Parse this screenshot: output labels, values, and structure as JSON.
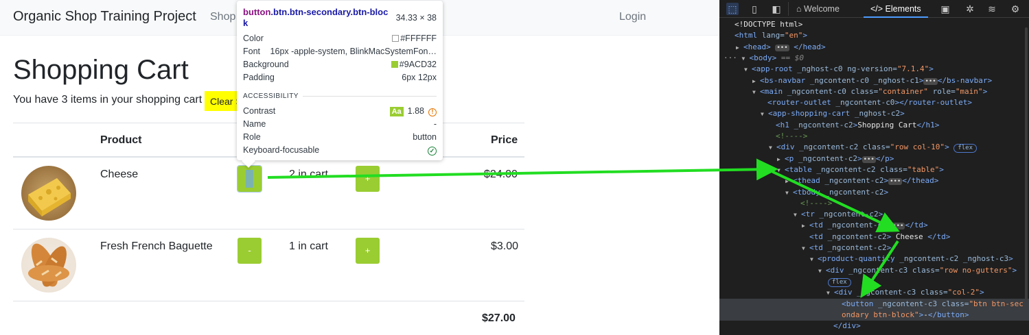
{
  "navbar": {
    "brand": "Organic Shop Training Project",
    "shop_link": "Shop",
    "login": "Login"
  },
  "page": {
    "title": "Shopping Cart",
    "cart_info": "You have 3 items in your shopping cart",
    "clear_button": "Clear Shopping Cart",
    "headers": {
      "product": "Product",
      "price": "Price"
    },
    "items": [
      {
        "name": "Cheese",
        "qty_label": "2 in cart",
        "minus": "-",
        "plus": "+",
        "price": "$24.00"
      },
      {
        "name": "Fresh French Baguette",
        "qty_label": "1 in cart",
        "minus": "-",
        "plus": "+",
        "price": "$3.00"
      }
    ],
    "total": "$27.00"
  },
  "tooltip": {
    "selector": "button",
    "classes": ".btn.btn-secondary.btn-bloc",
    "classes_wrap": "k",
    "dims": "34.33 × 38",
    "rows": [
      {
        "key": "Color",
        "value": "#FFFFFF",
        "swatch": "#FFFFFF"
      },
      {
        "key": "Font",
        "value": "16px -apple-system, BlinkMacSystemFon…"
      },
      {
        "key": "Background",
        "value": "#9ACD32",
        "swatch": "#9ACD32"
      },
      {
        "key": "Padding",
        "value": "6px 12px"
      }
    ],
    "section": "ACCESSIBILITY",
    "contrast_label": "Contrast",
    "contrast_badge": "Aa",
    "contrast_value": "1.88",
    "name_label": "Name",
    "name_value": "-",
    "role_label": "Role",
    "role_value": "button",
    "focus_label": "Keyboard-focusable"
  },
  "devtools": {
    "tabs": {
      "welcome": "Welcome",
      "elements": "Elements"
    },
    "dom": {
      "l0": "<!DOCTYPE html>",
      "l1_tag": "<html",
      "l1_an": " lang=",
      "l1_av": "\"en\"",
      "l1_end": ">",
      "l2": "<head>",
      "l2_end": "</head>",
      "l3": "<body>",
      "l3_eq": "== $0",
      "l4_tag": "<app-root",
      "l4_an": " _nghost-c0 ng-version=",
      "l4_av": "\"7.1.4\"",
      "l4_end": ">",
      "l5_tag": "<bs-navbar",
      "l5_an": " _ngcontent-c0 _nghost-c1",
      "l5_close": "</bs-navbar>",
      "l6_tag": "<main",
      "l6_an": " _ngcontent-c0 class=",
      "l6_av": "\"container\"",
      "l6_an2": " role=",
      "l6_av2": "\"main\"",
      "l7_tag": "<router-outlet",
      "l7_an": " _ngcontent-c0",
      "l7_close": "</router-outlet>",
      "l8_tag": "<app-shopping-cart",
      "l8_an": " _nghost-c2",
      "l9_tag": "<h1",
      "l9_an": " _ngcontent-c2",
      "l9_text": "Shopping Cart",
      "l9_close": "</h1>",
      "l10": "<!---->",
      "l11_tag": "<div",
      "l11_an": " _ngcontent-c2 class=",
      "l11_av": "\"row col-10\"",
      "l11_badge": "flex",
      "l12_tag": "<p",
      "l12_an": " _ngcontent-c2",
      "l12_close": "</p>",
      "l13_tag": "<table",
      "l13_an": " _ngcontent-c2 class=",
      "l13_av": "\"table\"",
      "l14_tag": "<thead",
      "l14_an": " _ngcontent-c2",
      "l14_close": "</thead>",
      "l15_tag": "<tbody",
      "l15_an": " _ngcontent-c2",
      "l16": "<!---->",
      "l17_tag": "<tr",
      "l17_an": " _ngcontent-c2",
      "l18_tag": "<td",
      "l18_an": " _ngcontent-c2",
      "l18_close": "</td>",
      "l19_tag": "<td",
      "l19_an": " _ngcontent-c2",
      "l19_text": " Cheese ",
      "l19_close": "</td>",
      "l20_tag": "<td",
      "l20_an": " _ngcontent-c2",
      "l21_tag": "<product-quantity",
      "l21_an": " _ngcontent-c2 _nghost-c3",
      "l22_tag": "<div",
      "l22_an": " _ngcontent-c3 class=",
      "l22_av": "\"row no-gutters\"",
      "l23_badge": "flex",
      "l24_tag": "<div",
      "l24_an": " _ngcontent-c3 class=",
      "l24_av": "\"col-2\"",
      "l25_tag": "<button",
      "l25_an": " _ngcontent-c3 class=",
      "l25_av": "\"btn btn-sec",
      "l26_av": "ondary btn-block\"",
      "l26_text": "-",
      "l26_close": "</button>",
      "l27": "</div>"
    }
  },
  "colors": {
    "accent_green": "#9ACD32",
    "clear_yellow": "#FFFF00",
    "arrow_green": "#22dd22"
  }
}
